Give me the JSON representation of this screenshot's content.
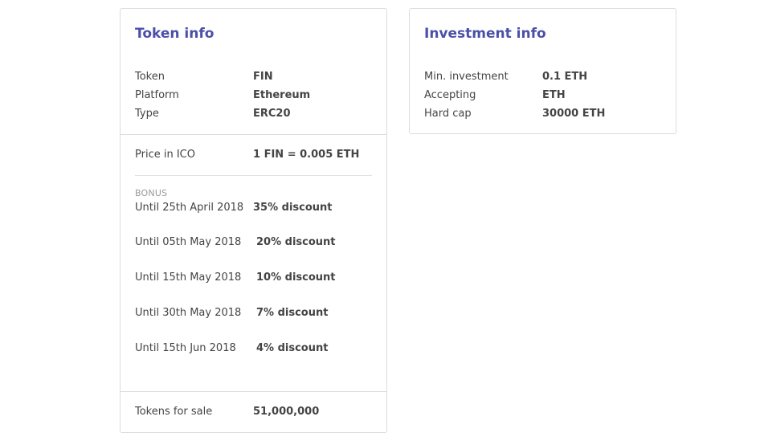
{
  "token_info": {
    "title": "Token info",
    "details": [
      {
        "label": "Token",
        "value": "FIN"
      },
      {
        "label": "Platform",
        "value": "Ethereum"
      },
      {
        "label": "Type",
        "value": "ERC20"
      }
    ],
    "price": {
      "label": "Price in ICO",
      "value": "1 FIN = 0.005 ETH"
    },
    "bonus_heading": "BONUS",
    "bonuses": [
      {
        "label": "Until 25th April 2018",
        "value": "35% discount"
      },
      {
        "label": "Until 05th May 2018",
        "value": "20% discount"
      },
      {
        "label": "Until 15th May 2018",
        "value": "10% discount"
      },
      {
        "label": "Until 30th May 2018",
        "value": "7% discount"
      },
      {
        "label": "Until 15th Jun 2018",
        "value": "4% discount"
      }
    ],
    "tokens_for_sale": {
      "label": "Tokens for sale",
      "value": "51,000,000"
    }
  },
  "investment_info": {
    "title": "Investment info",
    "details": [
      {
        "label": "Min. investment",
        "value": "0.1 ETH"
      },
      {
        "label": "Accepting",
        "value": "ETH"
      },
      {
        "label": "Hard cap",
        "value": "30000 ETH"
      }
    ]
  }
}
